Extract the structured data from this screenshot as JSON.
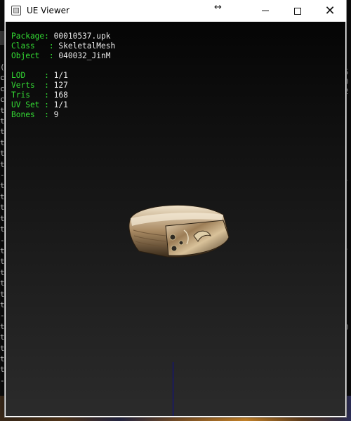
{
  "window": {
    "title": "UE Viewer"
  },
  "info": {
    "package": {
      "label": "Package",
      "value": "00010537.upk"
    },
    "class": {
      "label": "Class",
      "value": "SkeletalMesh"
    },
    "object": {
      "label": "Object",
      "value": "040032_JinM"
    },
    "lod": {
      "label": "LOD",
      "value": "1/1"
    },
    "verts": {
      "label": "Verts",
      "value": "127"
    },
    "tris": {
      "label": "Tris",
      "value": "168"
    },
    "uvset": {
      "label": "UV Set",
      "value": "1/1"
    },
    "bones": {
      "label": "Bones",
      "value": "9"
    }
  },
  "background_console": {
    "left_chars": "(\nc\nc\nc\nt\nt\nt\nt\nt\nt\n-\nt\nt\nt\nt\nt\n-\nt\nt\nt\nt\nt\nt\n-\nt\nt\nt\nt\nt\n-\nt\nt\nt",
    "right_chars": "S\n0\n2\n\n\n\n\n\n\n\n\n-\n\n\n\n\n\n\n-\n\n\n\n\n\n\n\n0\n\n\n-"
  },
  "colors": {
    "label_green": "#34dd34",
    "value_white": "#ececec",
    "axis_blue": "#0a0a9a"
  },
  "icons": {
    "app": "ue-viewer-app-icon",
    "resize": "horizontal-resize-arrow"
  }
}
